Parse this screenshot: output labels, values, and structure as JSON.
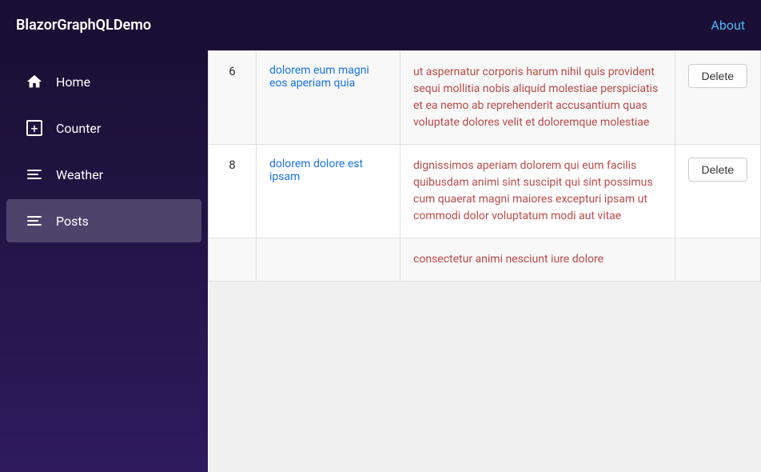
{
  "app": {
    "title": "BlazorGraphQLDemo",
    "about_label": "About"
  },
  "sidebar": {
    "items": [
      {
        "id": "home",
        "label": "Home",
        "icon": "home",
        "active": false
      },
      {
        "id": "counter",
        "label": "Counter",
        "icon": "counter",
        "active": false
      },
      {
        "id": "weather",
        "label": "Weather",
        "icon": "lines",
        "active": false
      },
      {
        "id": "posts",
        "label": "Posts",
        "icon": "lines",
        "active": true
      }
    ]
  },
  "table": {
    "rows": [
      {
        "id": 6,
        "title": "dolorem eum magni eos aperiam quia",
        "body": "ut aspernatur corporis harum nihil quis provident sequi mollitia nobis aliquid molestiae perspiciatis et ea nemo ab reprehenderit accusantium quas voluptate dolores velit et doloremque molestiae",
        "action": "Delete"
      },
      {
        "id": 8,
        "title": "dolorem dolore est ipsam",
        "body": "dignissimos aperiam dolorem qui eum facilis quibusdam animi sint suscipit qui sint possimus cum quaerat magni maiores excepturi ipsam ut commodi dolor voluptatum modi aut vitae",
        "action": "Delete"
      },
      {
        "id": null,
        "title": "",
        "body": "consectetur animi nesciunt iure dolore",
        "action": ""
      }
    ]
  }
}
